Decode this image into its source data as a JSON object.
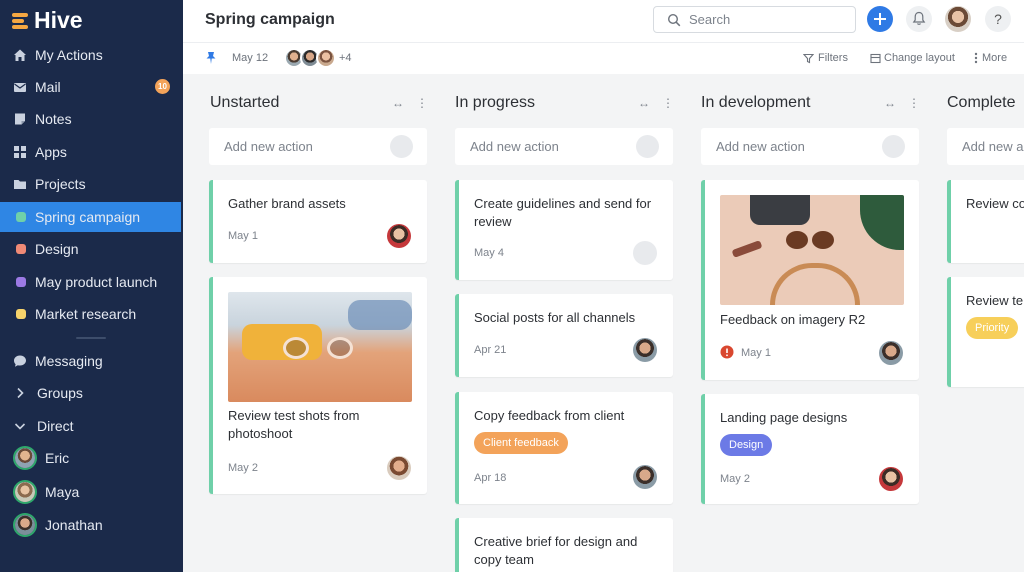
{
  "app": {
    "name": "Hive"
  },
  "sidebar": {
    "items": [
      {
        "label": "My Actions",
        "icon": "home-icon"
      },
      {
        "label": "Mail",
        "icon": "mail-icon",
        "badge": "10"
      },
      {
        "label": "Notes",
        "icon": "notes-icon"
      },
      {
        "label": "Apps",
        "icon": "apps-icon"
      },
      {
        "label": "Projects",
        "icon": "folder-icon"
      },
      {
        "label": "Spring campaign",
        "color": "#6fd0a9",
        "active": true
      },
      {
        "label": "Design",
        "color": "#f08a76"
      },
      {
        "label": "May product launch",
        "color": "#9c7ae4"
      },
      {
        "label": "Market research",
        "color": "#f7d36b"
      }
    ],
    "messaging": "Messaging",
    "groups": "Groups",
    "direct": "Direct",
    "people": [
      "Eric",
      "Maya",
      "Jonathan"
    ]
  },
  "header": {
    "title": "Spring campaign",
    "search_placeholder": "Search",
    "date": "May 12",
    "more_people": "+4",
    "filters": "Filters",
    "change_layout": "Change layout",
    "more": "More"
  },
  "columns": [
    {
      "title": "Unstarted",
      "add_placeholder": "Add new action",
      "cards": [
        {
          "title": "Gather brand assets",
          "date": "May 1"
        },
        {
          "title": "Review test shots from photoshoot",
          "date": "May 2"
        }
      ]
    },
    {
      "title": "In progress",
      "add_placeholder": "Add new action",
      "cards": [
        {
          "title": "Create guidelines and send for review",
          "date": "May 4"
        },
        {
          "title": "Social posts for all channels",
          "date": "Apr 21"
        },
        {
          "title": "Copy feedback from client",
          "tag": "Client feedback",
          "date": "Apr 18"
        },
        {
          "title": "Creative brief for design and copy team"
        }
      ]
    },
    {
      "title": "In development",
      "add_placeholder": "Add new action",
      "cards": [
        {
          "title": "Feedback on imagery R2",
          "date": "May 1"
        },
        {
          "title": "Landing page designs",
          "tag": "Design",
          "date": "May 2"
        }
      ]
    },
    {
      "title": "Complete",
      "add_placeholder": "Add new a",
      "cards": [
        {
          "title": "Review co"
        },
        {
          "title": "Review te",
          "tag": "Priority"
        }
      ]
    }
  ],
  "colors": {
    "sidebar_bg": "#1b2a4a",
    "active_bg": "#2f86e4",
    "card_accent": "#6fd0a9",
    "client_feedback_tag": "#f3a35a",
    "design_tag": "#6c7ae6",
    "priority_tag": "#f7cf5a",
    "plus_button": "#2f7ae5"
  }
}
